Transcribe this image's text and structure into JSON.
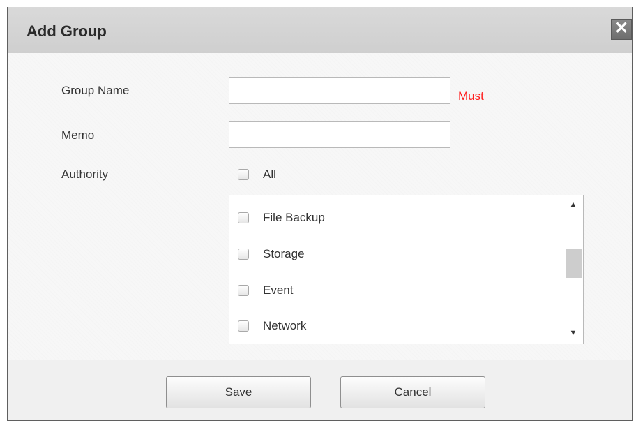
{
  "dialog": {
    "title": "Add Group",
    "close_glyph": "✕"
  },
  "form": {
    "group_name_label": "Group Name",
    "group_name_value": "",
    "must_text": "Must",
    "memo_label": "Memo",
    "memo_value": "",
    "authority_label": "Authority",
    "all_label": "All",
    "authority_items": [
      "File Backup",
      "Storage",
      "Event",
      "Network"
    ]
  },
  "footer": {
    "save_label": "Save",
    "cancel_label": "Cancel"
  },
  "scroll": {
    "up_glyph": "▲",
    "down_glyph": "▼"
  }
}
